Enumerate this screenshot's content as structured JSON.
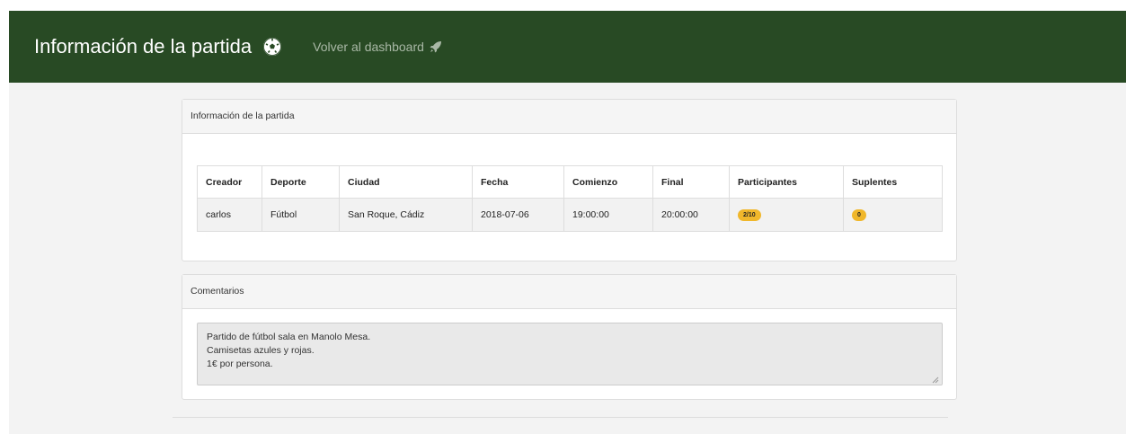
{
  "navbar": {
    "title": "Información de la partida",
    "title_icon": "soccer-ball-icon",
    "back_link": "Volver al dashboard",
    "back_icon": "rocket-icon",
    "background_color": "#284a24"
  },
  "info_panel": {
    "heading": "Información de la partida",
    "columns": [
      "Creador",
      "Deporte",
      "Ciudad",
      "Fecha",
      "Comienzo",
      "Final",
      "Participantes",
      "Suplentes"
    ],
    "row": {
      "creador": "carlos",
      "deporte": "Fútbol",
      "ciudad": "San Roque, Cádiz",
      "fecha": "2018-07-06",
      "comienzo": "19:00:00",
      "final": "20:00:00",
      "participantes": "2/10",
      "suplentes": "0"
    },
    "badge_color": "#f0b72b"
  },
  "comments_panel": {
    "heading": "Comentarios",
    "lines": [
      "Partido de fútbol sala en Manolo Mesa.",
      "Camisetas azules y rojas.",
      "1€ por persona."
    ]
  }
}
